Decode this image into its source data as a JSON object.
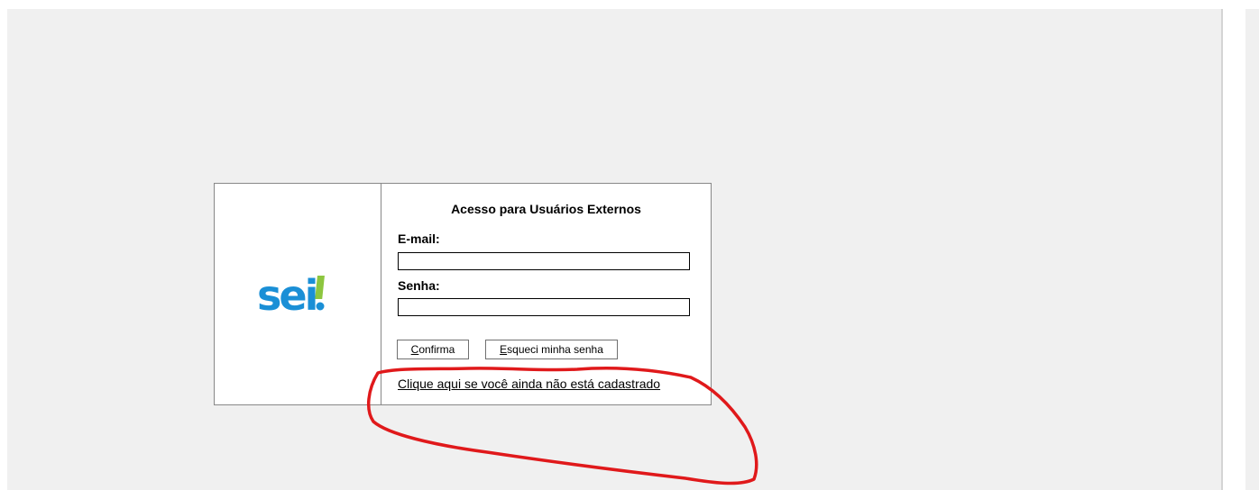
{
  "logo": {
    "text_main": "sei",
    "text_accent": "!",
    "colors": {
      "main": "#1a8fd6",
      "accent": "#8dc63f",
      "dot": "#1a8fd6"
    }
  },
  "login": {
    "title": "Acesso para Usuários Externos",
    "email_label": "E-mail:",
    "email_value": "",
    "senha_label": "Senha:",
    "senha_value": "",
    "confirma_accesskey": "C",
    "confirma_rest": "onfirma",
    "esqueci_accesskey": "E",
    "esqueci_rest": "squeci minha senha",
    "register_link": "Clique aqui se você ainda não está cadastrado"
  },
  "annotation": {
    "color": "#e0191b"
  }
}
